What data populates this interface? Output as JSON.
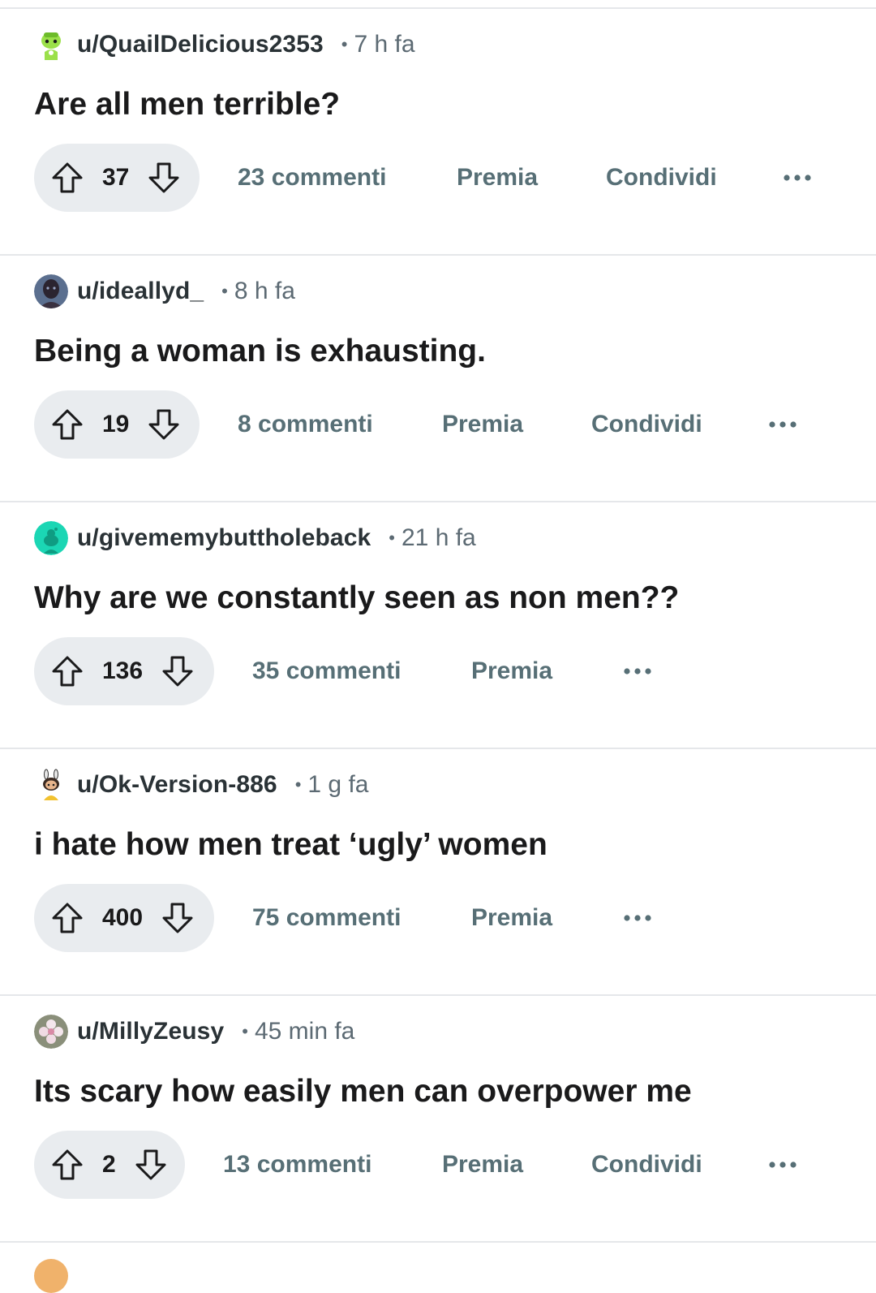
{
  "feed": {
    "posts": [
      {
        "username": "u/QuailDelicious2353",
        "time": "7 h fa",
        "title": "Are all men terrible?",
        "votes": "37",
        "comments": "23 commenti",
        "award": "Premia",
        "share": "Condividi",
        "avatar_icon": "snoo-green-avatar-icon"
      },
      {
        "username": "u/ideallyd_",
        "time": "8 h fa",
        "title": "Being a woman is exhausting.",
        "votes": "19",
        "comments": "8 commenti",
        "award": "Premia",
        "share": "Condividi",
        "avatar_icon": "dark-portrait-avatar-icon"
      },
      {
        "username": "u/givememybuttholeback",
        "time": "21 h fa",
        "title": "Why are we constantly seen as non men??",
        "votes": "136",
        "comments": "35 commenti",
        "award": "Premia",
        "avatar_icon": "snoo-teal-avatar-icon"
      },
      {
        "username": "u/Ok-Version-886",
        "time": "1 g fa",
        "title": "i hate how men treat ‘ugly’ women",
        "votes": "400",
        "comments": "75 commenti",
        "award": "Premia",
        "avatar_icon": "snoo-bunny-avatar-icon"
      },
      {
        "username": "u/MillyZeusy",
        "time": "45 min fa",
        "title": "Its scary how easily men can overpower me",
        "votes": "2",
        "comments": "13 commenti",
        "award": "Premia",
        "share": "Condividi",
        "avatar_icon": "flower-photo-avatar-icon"
      }
    ]
  },
  "icons": {
    "upvote": "arrow-up-icon",
    "downvote": "arrow-down-icon",
    "more": "more-dots-icon",
    "separator": "•"
  },
  "colors": {
    "meta_text": "#5c6a73",
    "action_text": "#576f76",
    "pill_bg": "#e9ecef",
    "divider": "#e5e7ea"
  }
}
